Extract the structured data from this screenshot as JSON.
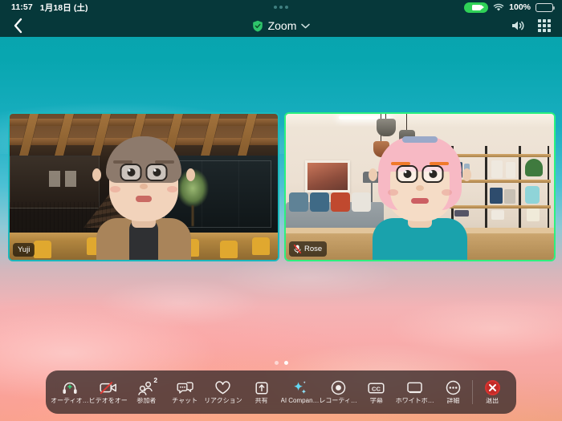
{
  "status_bar": {
    "time": "11:57",
    "date": "1月18日 (土)",
    "camera_indicator": "camera-active",
    "wifi": "wifi-icon",
    "battery_percent": "100%",
    "battery": "battery-full-icon",
    "multitask_handle": "three-dots-handle"
  },
  "nav_bar": {
    "back": "chevron-left-icon",
    "shield": "shield-check-icon",
    "title": "Zoom",
    "chevron": "chevron-down-icon",
    "speaker": "speaker-icon",
    "apps_grid": "grid-icon"
  },
  "meeting": {
    "tiles": [
      {
        "name": "Yuji",
        "active_speaker": false,
        "muted": false,
        "border_color": "#19b8bd",
        "avatar": {
          "hair_color": "#8d7a6c",
          "skin_color": "#f2d3bb",
          "top_color": "#a9845a",
          "inner_top_color": "#2f3033",
          "brow_color": "#6d5a4c",
          "scene": "wooden-cafe"
        }
      },
      {
        "name": "Rose",
        "active_speaker": true,
        "muted": true,
        "mute_icon": "mic-muted-icon",
        "border_color": "#2cf07f",
        "avatar": {
          "hair_color": "#f7b9c4",
          "skin_color": "#f5dcc6",
          "top_color": "#1aa2ac",
          "inner_top_color": "#1aa2ac",
          "brow_color": "#f07a2a",
          "scene": "living-room"
        }
      }
    ],
    "page_indicator": {
      "pages": 2,
      "current": 2
    }
  },
  "toolbar": {
    "items": [
      {
        "icon": "headset-icon",
        "label": "オーディオ…",
        "badge": null
      },
      {
        "icon": "video-off-icon",
        "label": "ビデオをオー…",
        "badge": null
      },
      {
        "icon": "participants-icon",
        "label": "参加者",
        "badge": "2"
      },
      {
        "icon": "chat-icon",
        "label": "チャット",
        "badge": null
      },
      {
        "icon": "heart-icon",
        "label": "リアクション",
        "badge": null
      },
      {
        "icon": "share-icon",
        "label": "共有",
        "badge": null
      },
      {
        "icon": "sparkle-icon",
        "label": "AI Compan…",
        "badge": null
      },
      {
        "icon": "record-icon",
        "label": "レコーディ…",
        "badge": null
      },
      {
        "icon": "cc-icon",
        "label": "字幕",
        "badge": null
      },
      {
        "icon": "whiteboard-icon",
        "label": "ホワイトボ…",
        "badge": null
      },
      {
        "icon": "more-icon",
        "label": "詳細",
        "badge": null
      },
      {
        "icon": "leave-icon",
        "label": "退出",
        "badge": null
      }
    ]
  },
  "colors": {
    "navbar": "#06383a",
    "toolbar": "rgba(60,45,44,0.80)",
    "active_speaker": "#2cf07f",
    "leave_red": "#c22b27",
    "camera_green": "#2fd157"
  }
}
